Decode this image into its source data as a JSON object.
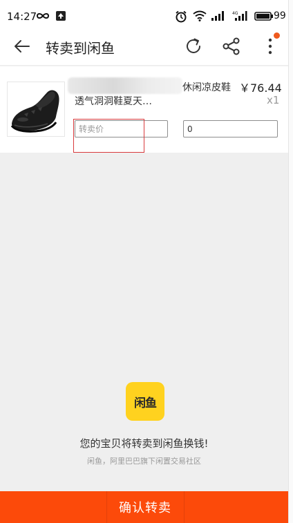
{
  "status_bar": {
    "time": "14:27",
    "battery": "99",
    "icons": [
      "infinity-icon",
      "upload-icon",
      "alarm-icon",
      "wifi-icon",
      "signal-icon",
      "signal-4g-icon",
      "battery-icon"
    ]
  },
  "app_bar": {
    "title": "转卖到闲鱼",
    "back_icon": "back-arrow-icon",
    "refresh_icon": "refresh-icon",
    "share_icon": "share-icon",
    "more_icon": "more-vertical-icon",
    "notification_color": "#ef5a1e"
  },
  "product": {
    "title_line1": "休闲凉皮鞋",
    "title_line2": "透气洞洞鞋夏天…",
    "price": "￥76.44",
    "quantity": "x1",
    "resale_price_placeholder": "转卖价",
    "original_price_value": "0"
  },
  "promo": {
    "logo_text": "闲鱼",
    "logo_color": "#ffd21f",
    "headline": "您的宝贝将转卖到闲鱼换钱!",
    "subline": "闲鱼，阿里巴巴旗下闲置交易社区"
  },
  "footer": {
    "confirm_label": "确认转卖",
    "confirm_color": "#fc4a0a"
  }
}
